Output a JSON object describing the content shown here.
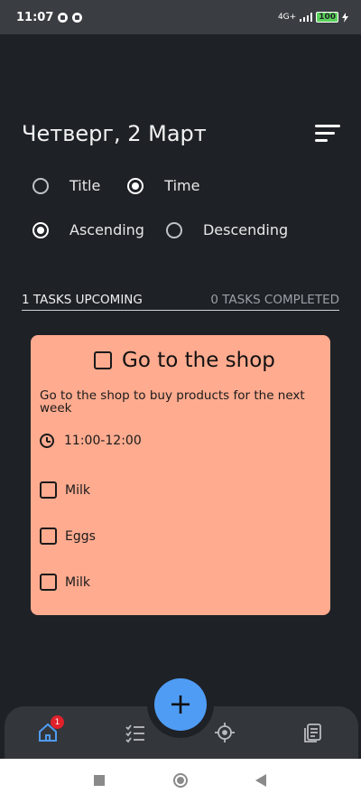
{
  "status_bar": {
    "time": "11:07",
    "network": "4G+",
    "battery": "100"
  },
  "header": {
    "date": "Четверг, 2 Март"
  },
  "sort_options": {
    "field": [
      {
        "label": "Title",
        "selected": false
      },
      {
        "label": "Time",
        "selected": true
      }
    ],
    "order": [
      {
        "label": "Ascending",
        "selected": true
      },
      {
        "label": "Descending",
        "selected": false
      }
    ]
  },
  "summary": {
    "upcoming": "1 TASKS UPCOMING",
    "completed": "0 TASKS COMPLETED"
  },
  "task": {
    "title": "Go to the shop",
    "description": "Go to the shop to buy products for the next week",
    "time": "11:00-12:00",
    "color": "#ffab8f",
    "subtasks": [
      "Milk",
      "Eggs",
      "Milk"
    ]
  },
  "fab": {
    "label": "+"
  },
  "bottom_nav": {
    "home_badge": "1",
    "accent": "#4f9cf5"
  }
}
